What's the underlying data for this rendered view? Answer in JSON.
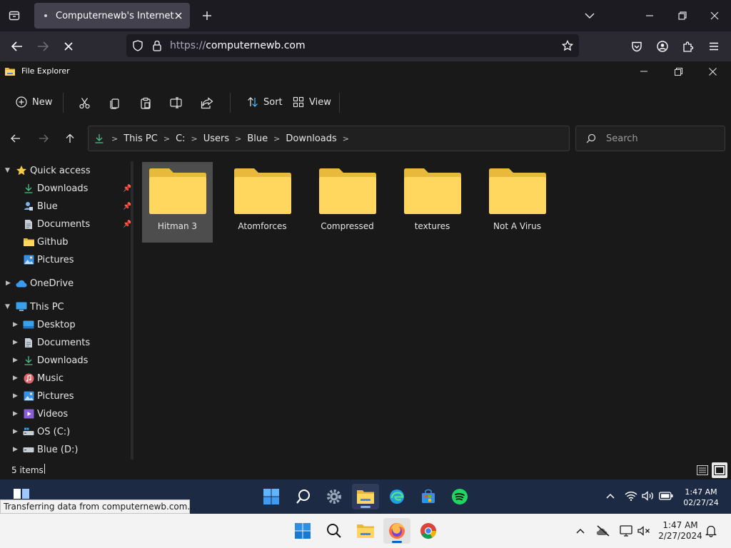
{
  "browser": {
    "tab_title": "Computernewb's Internet Pub I",
    "url_protocol": "https://",
    "url_host": "computernewb.com"
  },
  "explorer": {
    "window_title": "File Explorer",
    "toolbar": {
      "new_label": "New",
      "sort_label": "Sort",
      "view_label": "View"
    },
    "breadcrumb": [
      "This PC",
      "C:",
      "Users",
      "Blue",
      "Downloads"
    ],
    "search_placeholder": "Search",
    "sidebar": {
      "quick_access": "Quick access",
      "quick_items": [
        "Downloads",
        "Blue",
        "Documents",
        "Github",
        "Pictures"
      ],
      "onedrive": "OneDrive",
      "this_pc": "This PC",
      "pc_items": [
        "Desktop",
        "Documents",
        "Downloads",
        "Music",
        "Pictures",
        "Videos",
        "OS (C:)",
        "Blue (D:)"
      ]
    },
    "folders": [
      "Hitman 3",
      "Atomforces",
      "Compressed",
      "textures",
      "Not A Virus"
    ],
    "status": "5 items"
  },
  "inner_taskbar": {
    "time": "1:47 AM",
    "date": "02/27/24",
    "transfer_status": "Transferring data from computernewb.com..."
  },
  "host_taskbar": {
    "time": "1:47 AM",
    "date": "2/27/2024"
  },
  "colors": {
    "folder_yellow": "#ffd75e",
    "accent_blue": "#4cc2ff",
    "inner_taskbar": "#1d2a44"
  }
}
